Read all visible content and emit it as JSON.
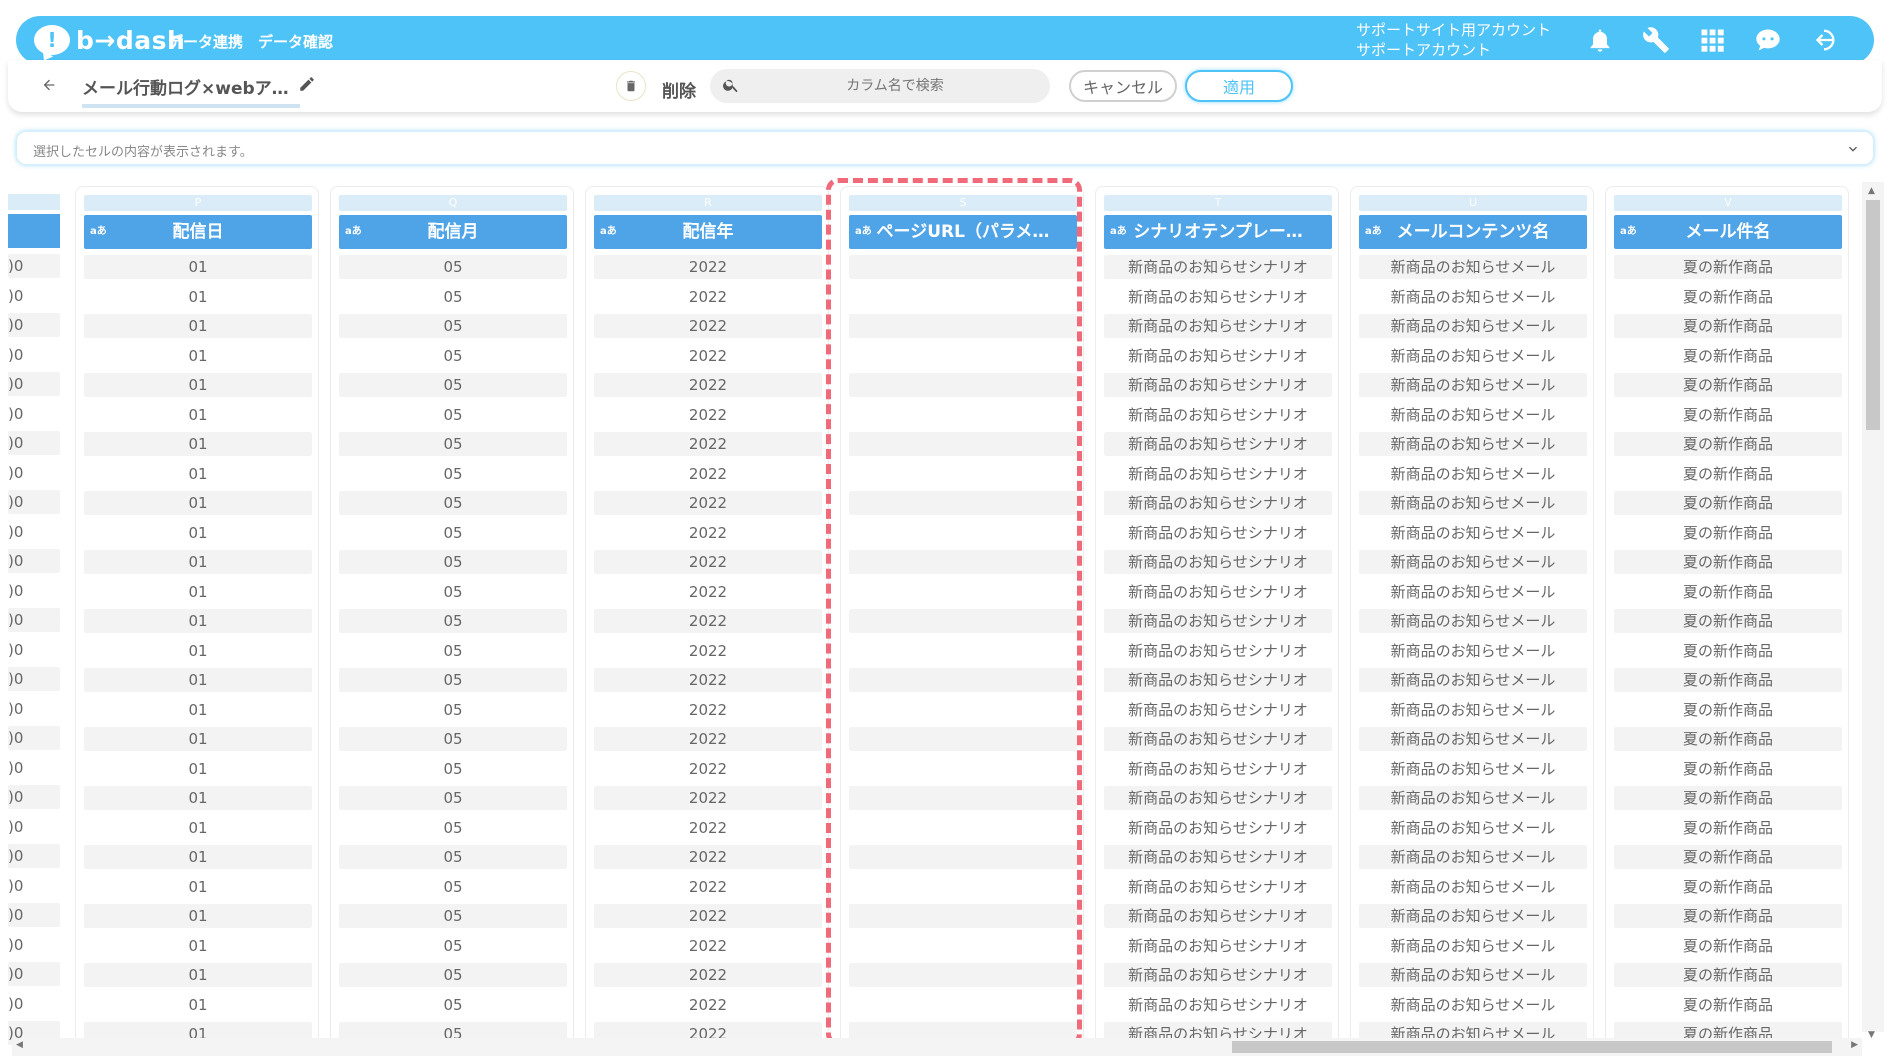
{
  "header": {
    "logo_text": "b→dash",
    "nav": [
      "データ連携",
      "データ確認"
    ],
    "account_line1": "サポートサイト用アカウント",
    "account_line2": "サポートアカウント",
    "accent_color": "#4ec3f7"
  },
  "titlebar": {
    "title": "メール行動ログ×webア…",
    "delete_label": "削除",
    "search_placeholder": "カラム名で検索",
    "cancel_label": "キャンセル",
    "apply_label": "適用"
  },
  "cellbar": {
    "placeholder": "選択したセルの内容が表示されます。"
  },
  "grid": {
    "partial_cell": ")0",
    "type_badge": "aあ",
    "columns": [
      {
        "letter": "P",
        "name": "配信日",
        "value": "01"
      },
      {
        "letter": "Q",
        "name": "配信月",
        "value": "05"
      },
      {
        "letter": "R",
        "name": "配信年",
        "value": "2022"
      },
      {
        "letter": "S",
        "name": "ページURL（パラメ…",
        "value": ""
      },
      {
        "letter": "T",
        "name": "シナリオテンプレー…",
        "value": "新商品のお知らせシナリオ"
      },
      {
        "letter": "U",
        "name": "メールコンテンツ名",
        "value": "新商品のお知らせメール"
      },
      {
        "letter": "V",
        "name": "メール件名",
        "value": "夏の新作商品"
      }
    ],
    "highlight_color": "#f06a7a"
  },
  "icons": [
    "bell-icon",
    "wrench-icon",
    "apps-grid-icon",
    "chat-support-icon",
    "logout-icon",
    "back-arrow-icon",
    "pencil-icon",
    "trash-icon",
    "search-icon",
    "chevron-down-icon"
  ]
}
